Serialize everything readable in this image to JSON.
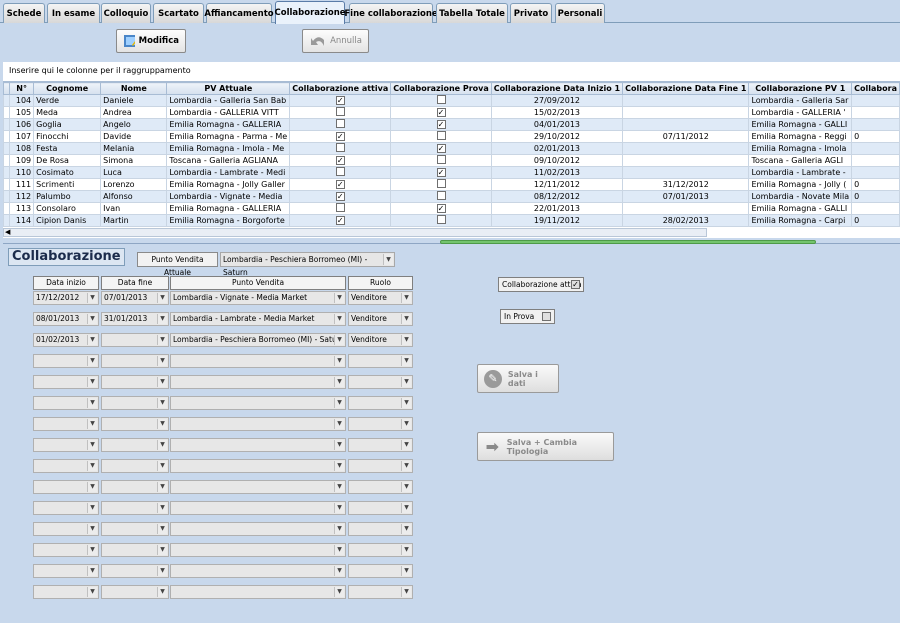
{
  "tabs": [
    "Schede",
    "In esame",
    "Colloquio",
    "Scartato",
    "Affiancamento",
    "Collaborazione",
    "Fine collaborazione",
    "Tabella Totale",
    "Privato",
    "Personali"
  ],
  "active_tab": "Collaborazione",
  "toolbar": {
    "modifica_label": "Modifica",
    "annulla_label": "Annulla"
  },
  "grid": {
    "group_hint": "Inserire qui le colonne per il raggruppamento",
    "headers": [
      "N°",
      "Cognome",
      "Nome",
      "PV Attuale",
      "Collaborazione attiva",
      "Collaborazione Prova",
      "Collaborazione Data Inizio 1",
      "Collaborazione Data Fine 1",
      "Collaborazione PV 1",
      "Collabora"
    ],
    "rows": [
      {
        "n": "104",
        "cognome": "Verde",
        "nome": "Daniele",
        "pv": "Lombardia - Galleria San Bab",
        "attiva": true,
        "prova": false,
        "inizio": "27/09/2012",
        "fine": "",
        "pv1": "Lombardia - Galleria Sar",
        "x": ""
      },
      {
        "n": "105",
        "cognome": "Meda",
        "nome": "Andrea",
        "pv": "Lombardia - GALLERIA VITT",
        "attiva": false,
        "prova": true,
        "inizio": "15/02/2013",
        "fine": "",
        "pv1": "Lombardia - GALLERIA '",
        "x": ""
      },
      {
        "n": "106",
        "cognome": "Goglia",
        "nome": "Angelo",
        "pv": "Emilia Romagna - GALLERIA",
        "attiva": false,
        "prova": true,
        "inizio": "04/01/2013",
        "fine": "",
        "pv1": "Emilia Romagna - GALLI",
        "x": ""
      },
      {
        "n": "107",
        "cognome": "Finocchi",
        "nome": "Davide",
        "pv": "Emilia Romagna - Parma - Me",
        "attiva": true,
        "prova": false,
        "inizio": "29/10/2012",
        "fine": "07/11/2012",
        "pv1": "Emilia Romagna - Reggi",
        "x": "0"
      },
      {
        "n": "108",
        "cognome": "Festa",
        "nome": "Melania",
        "pv": "Emilia Romagna - Imola - Me",
        "attiva": false,
        "prova": true,
        "inizio": "02/01/2013",
        "fine": "",
        "pv1": "Emilia Romagna - Imola",
        "x": ""
      },
      {
        "n": "109",
        "cognome": "De Rosa",
        "nome": "Simona",
        "pv": "Toscana - Galleria AGLIANA",
        "attiva": true,
        "prova": false,
        "inizio": "09/10/2012",
        "fine": "",
        "pv1": "Toscana - Galleria AGLI",
        "x": ""
      },
      {
        "n": "110",
        "cognome": "Cosimato",
        "nome": "Luca",
        "pv": "Lombardia - Lambrate - Medi",
        "attiva": false,
        "prova": true,
        "inizio": "11/02/2013",
        "fine": "",
        "pv1": "Lombardia - Lambrate -",
        "x": ""
      },
      {
        "n": "111",
        "cognome": "Scrimenti",
        "nome": "Lorenzo",
        "pv": "Emilia Romagna - Jolly Galler",
        "attiva": true,
        "prova": false,
        "inizio": "12/11/2012",
        "fine": "31/12/2012",
        "pv1": "Emilia Romagna - Jolly (",
        "x": "0"
      },
      {
        "n": "112",
        "cognome": "Palumbo",
        "nome": "Alfonso",
        "pv": "Lombardia - Vignate - Media",
        "attiva": true,
        "prova": false,
        "inizio": "08/12/2012",
        "fine": "07/01/2013",
        "pv1": "Lombardia - Novate Mila",
        "x": "0"
      },
      {
        "n": "113",
        "cognome": "Consolaro",
        "nome": "Ivan",
        "pv": "Emilia Romagna - GALLERIA",
        "attiva": false,
        "prova": true,
        "inizio": "22/01/2013",
        "fine": "",
        "pv1": "Emilia Romagna - GALLI",
        "x": ""
      },
      {
        "n": "114",
        "cognome": "Cipion Danis",
        "nome": "Martin",
        "pv": "Emilia Romagna - Borgoforte",
        "attiva": true,
        "prova": false,
        "inizio": "19/11/2012",
        "fine": "28/02/2013",
        "pv1": "Emilia Romagna - Carpi",
        "x": "0"
      }
    ]
  },
  "panel": {
    "title": "Collaborazione",
    "pva_label": "Punto Vendita Attuale",
    "pva_value": "Lombardia - Peschiera Borromeo (MI) - Saturn",
    "col_headers": {
      "inizio": "Data inizio",
      "fine": "Data fine",
      "pv": "Punto Vendita",
      "ruolo": "Ruolo"
    },
    "entries": [
      {
        "inizio": "17/12/2012",
        "fine": "07/01/2013",
        "pv": "Lombardia - Vignate - Media Market",
        "ruolo": "Venditore"
      },
      {
        "inizio": "08/01/2013",
        "fine": "31/01/2013",
        "pv": "Lombardia - Lambrate - Media Market",
        "ruolo": "Venditore"
      },
      {
        "inizio": "01/02/2013",
        "fine": "",
        "pv": "Lombardia - Peschiera Borromeo (MI) - Saturn",
        "ruolo": "Venditore"
      }
    ],
    "empty_rows": 12,
    "collab_attiva_label": "Collaborazione attiva",
    "collab_attiva_checked": true,
    "in_prova_label": "In Prova",
    "in_prova_checked": false,
    "salva_label": "Salva i dati",
    "salva_cambia_label": "Salva + Cambia Tipologia"
  }
}
